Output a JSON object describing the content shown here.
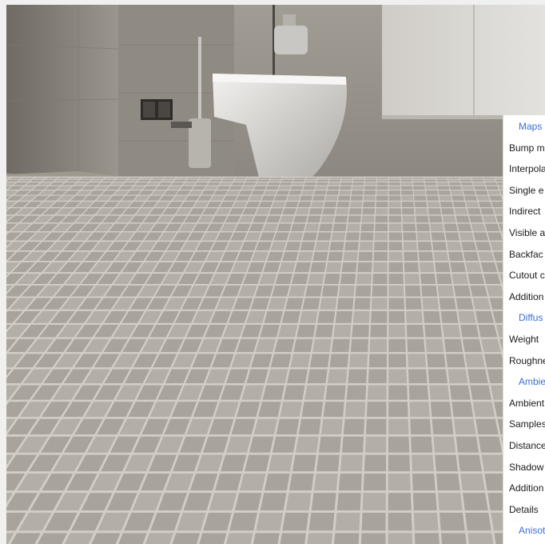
{
  "properties_panel": {
    "rows": [
      {
        "label": "Maps",
        "section": true
      },
      {
        "label": "Bump m",
        "section": false
      },
      {
        "label": "Interpola",
        "section": false
      },
      {
        "label": "Single e",
        "section": false
      },
      {
        "label": "Indirect",
        "section": false
      },
      {
        "label": "Visible a",
        "section": false
      },
      {
        "label": "Backfac",
        "section": false
      },
      {
        "label": "Cutout c",
        "section": false
      },
      {
        "label": "Addition",
        "section": false
      },
      {
        "label": "Diffus",
        "section": true
      },
      {
        "label": "Weight",
        "section": false
      },
      {
        "label": "Roughne",
        "section": false
      },
      {
        "label": "Ambie",
        "section": true
      },
      {
        "label": "Ambient",
        "section": false
      },
      {
        "label": "Samples",
        "section": false
      },
      {
        "label": "Distance",
        "section": false
      },
      {
        "label": "Shadow",
        "section": false
      },
      {
        "label": "Addition",
        "section": false
      },
      {
        "label": "Details",
        "section": false
      },
      {
        "label": "Anisot",
        "section": true
      }
    ]
  },
  "colors": {
    "section_text": "#3a6fd1",
    "row_text": "#1a1a1a",
    "tile_face": "#a8a49c",
    "grout": "#d2cec6",
    "wall": "#8e8880",
    "cabinet": "#d8d6d2",
    "toilet": "#dedcd8"
  },
  "icons": [
    "toilet-icon",
    "paper-holder-icon",
    "brush-holder-icon",
    "flush-plate-icon"
  ]
}
